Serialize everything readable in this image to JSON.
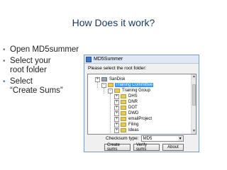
{
  "slide": {
    "title": "How Does it work?",
    "bullets": [
      "Open MD5summer",
      "Select your\nroot folder",
      "Select\n“Create Sums”"
    ]
  },
  "dialog": {
    "title": "MD5Summer",
    "prompt": "Please select the root folder:",
    "tree": [
      {
        "label": "SanDisk",
        "expander": "+",
        "type": "drive"
      },
      {
        "label": "Training Committee",
        "expander": "-",
        "type": "folder",
        "selected": true
      },
      {
        "label": "Training Group",
        "expander": "-",
        "type": "folder"
      },
      {
        "label": "DHS",
        "expander": "+",
        "type": "folder"
      },
      {
        "label": "DNR",
        "expander": "+",
        "type": "folder"
      },
      {
        "label": "DOT",
        "expander": "+",
        "type": "folder"
      },
      {
        "label": "DWD",
        "expander": "+",
        "type": "folder"
      },
      {
        "label": "emailProject",
        "expander": "+",
        "type": "folder"
      },
      {
        "label": "Filing",
        "expander": "+",
        "type": "folder"
      },
      {
        "label": "Ideas",
        "expander": "+",
        "type": "folder"
      }
    ],
    "checksum_type_label": "Checksum type:",
    "checksum_type_value": "MD5",
    "buttons": {
      "create": "Create sums",
      "verify": "Verify sums",
      "about": "About"
    },
    "colors": {
      "selection": "#3399ff",
      "folder": "#e8c85a",
      "title_text": "#17375e",
      "bullet": "#4f81bd"
    }
  }
}
